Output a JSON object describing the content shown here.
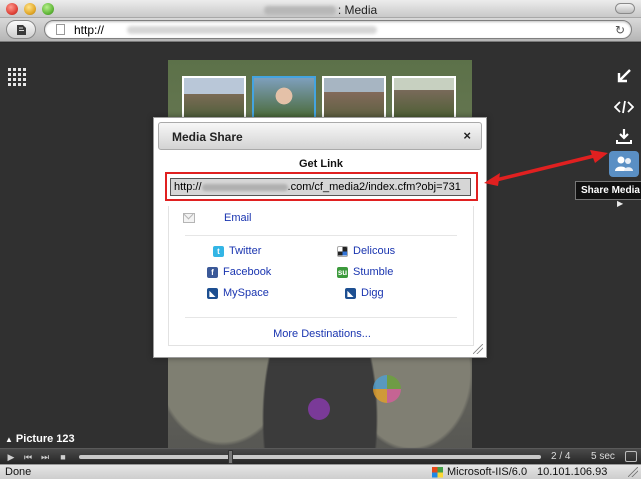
{
  "window": {
    "title_suffix": ": Media"
  },
  "address_bar": {
    "url_prefix": "http://"
  },
  "player": {
    "picture_label": "Picture 123",
    "slide_counter": "2 / 4",
    "interval": "5 sec"
  },
  "side_toolbar": {
    "share_tooltip": "Share Media",
    "icons": [
      "shrink-icon",
      "embed-code-icon",
      "download-icon",
      "share-media-icon"
    ]
  },
  "modal": {
    "title": "Media Share",
    "close_glyph": "×",
    "get_link_label": "Get Link",
    "link_prefix": "http://",
    "link_suffix": ".com/cf_media2/index.cfm?obj=731",
    "email_label": "Email",
    "destinations": {
      "twitter": "Twitter",
      "delicious": "Delicous",
      "facebook": "Facebook",
      "stumble": "Stumble",
      "myspace": "MySpace",
      "digg": "Digg"
    },
    "more_destinations": "More Destinations..."
  },
  "status_bar": {
    "status": "Done",
    "server": "Microsoft-IIS/6.0",
    "ip": "10.101.106.93"
  },
  "colors": {
    "annotation_red": "#e02020",
    "link_blue": "#1a35b0",
    "share_button_blue": "#5a8fc4"
  }
}
